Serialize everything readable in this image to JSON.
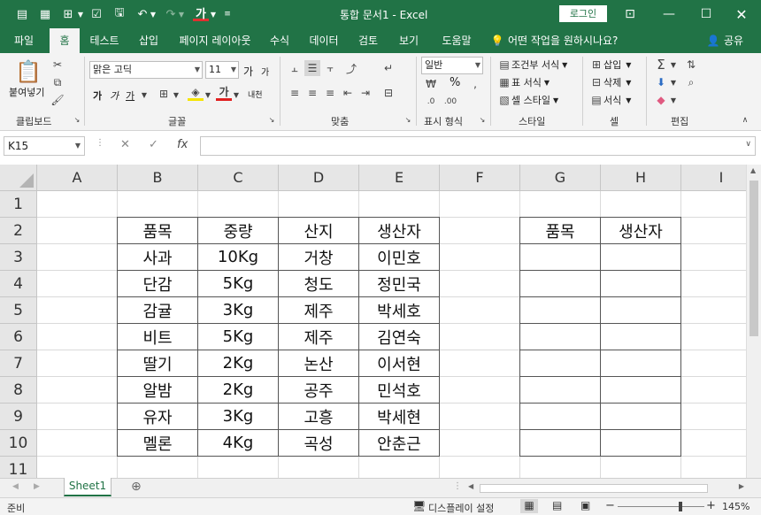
{
  "titlebar": {
    "title": "통합 문서1  -  Excel",
    "login": "로그인",
    "font_color_glyph": "가"
  },
  "tabs": [
    "파일",
    "홈",
    "테스트",
    "삽입",
    "페이지 레이아웃",
    "수식",
    "데이터",
    "검토",
    "보기",
    "도움말"
  ],
  "active_tab": "홈",
  "tell_me": "어떤 작업을 원하시나요?",
  "share": "공유",
  "ribbon": {
    "clipboard": {
      "paste": "붙여넣기",
      "label": "클립보드"
    },
    "font": {
      "name": "맑은 고딕",
      "size": "11",
      "grow": "가",
      "shrink": "가",
      "bold": "가",
      "italic": "가",
      "underline": "가",
      "font_color": "가",
      "phonetic": "내천",
      "label": "글꼴"
    },
    "alignment": {
      "label": "맞춤"
    },
    "number": {
      "format": "일반",
      "label": "표시 형식",
      "percent": "%"
    },
    "styles": {
      "conditional": "조건부 서식",
      "table": "표 서식",
      "cell": "셀 스타일",
      "label": "스타일"
    },
    "cells": {
      "insert": "삽입",
      "delete": "삭제",
      "format": "서식",
      "label": "셀"
    },
    "editing": {
      "label": "편집"
    }
  },
  "formula_bar": {
    "name_box": "K15",
    "fx": "fx",
    "content": ""
  },
  "columns": [
    "A",
    "B",
    "C",
    "D",
    "E",
    "F",
    "G",
    "H",
    "I"
  ],
  "rows": [
    "1",
    "2",
    "3",
    "4",
    "5",
    "6",
    "7",
    "8",
    "9",
    "10",
    "11"
  ],
  "table_left": {
    "headers": [
      "품목",
      "중량",
      "산지",
      "생산자"
    ],
    "rows": [
      [
        "사과",
        "10Kg",
        "거창",
        "이민호"
      ],
      [
        "단감",
        "5Kg",
        "청도",
        "정민국"
      ],
      [
        "감귤",
        "3Kg",
        "제주",
        "박세호"
      ],
      [
        "비트",
        "5Kg",
        "제주",
        "김연숙"
      ],
      [
        "딸기",
        "2Kg",
        "논산",
        "이서현"
      ],
      [
        "알밤",
        "2Kg",
        "공주",
        "민석호"
      ],
      [
        "유자",
        "3Kg",
        "고흥",
        "박세현"
      ],
      [
        "멜론",
        "4Kg",
        "곡성",
        "안춘근"
      ]
    ]
  },
  "table_right": {
    "headers": [
      "품목",
      "생산자"
    ],
    "empty_rows": 8
  },
  "sheet_tab": "Sheet1",
  "status": {
    "ready": "준비",
    "display": "디스플레이 설정",
    "zoom": "145%",
    "zoom_level": 0.72
  },
  "colors": {
    "accent": "#217346",
    "ribbon": "#f3f3f3",
    "header": "#e6e6e6"
  }
}
